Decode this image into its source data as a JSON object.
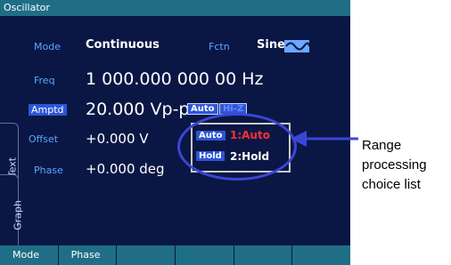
{
  "title": "Oscillator",
  "fields": {
    "mode": {
      "label": "Mode",
      "value": "Continuous"
    },
    "fctn": {
      "label": "Fctn",
      "value": "Sine"
    },
    "freq": {
      "label": "Freq",
      "value": "1 000.000 000 00 Hz"
    },
    "amptd": {
      "label": "Amptd",
      "value": "20.000 Vp-p"
    },
    "offset": {
      "label": "Offset",
      "value": "+0.000 V"
    },
    "phase": {
      "label": "Phase",
      "value": "+0.000 deg"
    }
  },
  "range_buttons": {
    "auto": "Auto",
    "hidden_button": "Hi-Z"
  },
  "popup": {
    "choices": [
      {
        "badge": "Auto",
        "text": "1:Auto"
      },
      {
        "badge": "Hold",
        "text": "2:Hold"
      }
    ]
  },
  "side_tabs": {
    "text": "Text",
    "graph": "Graph"
  },
  "menu": [
    "Mode",
    "Phase",
    "",
    "",
    "",
    ""
  ],
  "annotation": {
    "line1": "Range",
    "line2": "processing",
    "line3": "choice list"
  },
  "colors": {
    "screen_bg": "#0a1744",
    "titlebar": "#1f6e86",
    "label": "#58a8ff",
    "value": "#ffffff",
    "selected": "#2d55d6",
    "highlight": "#ff3030",
    "callout": "#3b46d8"
  },
  "icons": {
    "fctn_wave": "sine-wave-icon"
  }
}
